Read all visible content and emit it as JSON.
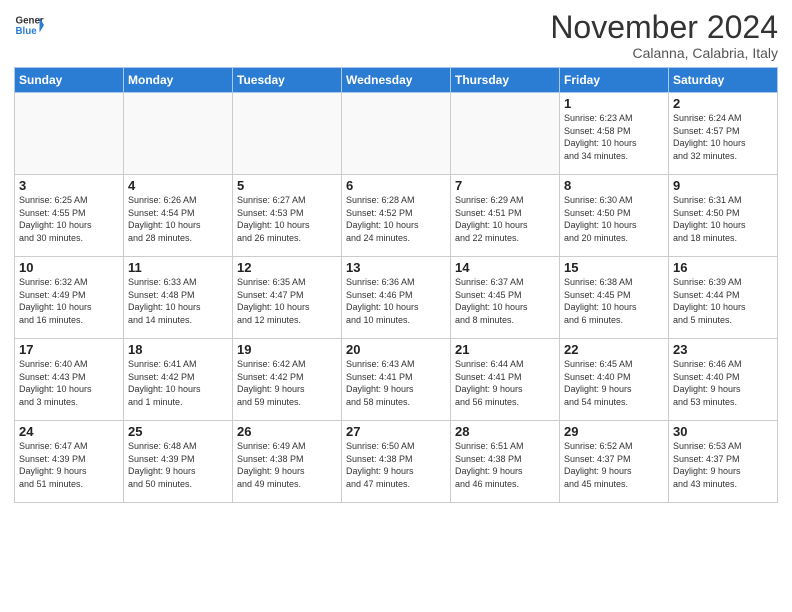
{
  "header": {
    "logo_line1": "General",
    "logo_line2": "Blue",
    "month": "November 2024",
    "location": "Calanna, Calabria, Italy"
  },
  "weekdays": [
    "Sunday",
    "Monday",
    "Tuesday",
    "Wednesday",
    "Thursday",
    "Friday",
    "Saturday"
  ],
  "weeks": [
    [
      {
        "day": "",
        "info": ""
      },
      {
        "day": "",
        "info": ""
      },
      {
        "day": "",
        "info": ""
      },
      {
        "day": "",
        "info": ""
      },
      {
        "day": "",
        "info": ""
      },
      {
        "day": "1",
        "info": "Sunrise: 6:23 AM\nSunset: 4:58 PM\nDaylight: 10 hours\nand 34 minutes."
      },
      {
        "day": "2",
        "info": "Sunrise: 6:24 AM\nSunset: 4:57 PM\nDaylight: 10 hours\nand 32 minutes."
      }
    ],
    [
      {
        "day": "3",
        "info": "Sunrise: 6:25 AM\nSunset: 4:55 PM\nDaylight: 10 hours\nand 30 minutes."
      },
      {
        "day": "4",
        "info": "Sunrise: 6:26 AM\nSunset: 4:54 PM\nDaylight: 10 hours\nand 28 minutes."
      },
      {
        "day": "5",
        "info": "Sunrise: 6:27 AM\nSunset: 4:53 PM\nDaylight: 10 hours\nand 26 minutes."
      },
      {
        "day": "6",
        "info": "Sunrise: 6:28 AM\nSunset: 4:52 PM\nDaylight: 10 hours\nand 24 minutes."
      },
      {
        "day": "7",
        "info": "Sunrise: 6:29 AM\nSunset: 4:51 PM\nDaylight: 10 hours\nand 22 minutes."
      },
      {
        "day": "8",
        "info": "Sunrise: 6:30 AM\nSunset: 4:50 PM\nDaylight: 10 hours\nand 20 minutes."
      },
      {
        "day": "9",
        "info": "Sunrise: 6:31 AM\nSunset: 4:50 PM\nDaylight: 10 hours\nand 18 minutes."
      }
    ],
    [
      {
        "day": "10",
        "info": "Sunrise: 6:32 AM\nSunset: 4:49 PM\nDaylight: 10 hours\nand 16 minutes."
      },
      {
        "day": "11",
        "info": "Sunrise: 6:33 AM\nSunset: 4:48 PM\nDaylight: 10 hours\nand 14 minutes."
      },
      {
        "day": "12",
        "info": "Sunrise: 6:35 AM\nSunset: 4:47 PM\nDaylight: 10 hours\nand 12 minutes."
      },
      {
        "day": "13",
        "info": "Sunrise: 6:36 AM\nSunset: 4:46 PM\nDaylight: 10 hours\nand 10 minutes."
      },
      {
        "day": "14",
        "info": "Sunrise: 6:37 AM\nSunset: 4:45 PM\nDaylight: 10 hours\nand 8 minutes."
      },
      {
        "day": "15",
        "info": "Sunrise: 6:38 AM\nSunset: 4:45 PM\nDaylight: 10 hours\nand 6 minutes."
      },
      {
        "day": "16",
        "info": "Sunrise: 6:39 AM\nSunset: 4:44 PM\nDaylight: 10 hours\nand 5 minutes."
      }
    ],
    [
      {
        "day": "17",
        "info": "Sunrise: 6:40 AM\nSunset: 4:43 PM\nDaylight: 10 hours\nand 3 minutes."
      },
      {
        "day": "18",
        "info": "Sunrise: 6:41 AM\nSunset: 4:42 PM\nDaylight: 10 hours\nand 1 minute."
      },
      {
        "day": "19",
        "info": "Sunrise: 6:42 AM\nSunset: 4:42 PM\nDaylight: 9 hours\nand 59 minutes."
      },
      {
        "day": "20",
        "info": "Sunrise: 6:43 AM\nSunset: 4:41 PM\nDaylight: 9 hours\nand 58 minutes."
      },
      {
        "day": "21",
        "info": "Sunrise: 6:44 AM\nSunset: 4:41 PM\nDaylight: 9 hours\nand 56 minutes."
      },
      {
        "day": "22",
        "info": "Sunrise: 6:45 AM\nSunset: 4:40 PM\nDaylight: 9 hours\nand 54 minutes."
      },
      {
        "day": "23",
        "info": "Sunrise: 6:46 AM\nSunset: 4:40 PM\nDaylight: 9 hours\nand 53 minutes."
      }
    ],
    [
      {
        "day": "24",
        "info": "Sunrise: 6:47 AM\nSunset: 4:39 PM\nDaylight: 9 hours\nand 51 minutes."
      },
      {
        "day": "25",
        "info": "Sunrise: 6:48 AM\nSunset: 4:39 PM\nDaylight: 9 hours\nand 50 minutes."
      },
      {
        "day": "26",
        "info": "Sunrise: 6:49 AM\nSunset: 4:38 PM\nDaylight: 9 hours\nand 49 minutes."
      },
      {
        "day": "27",
        "info": "Sunrise: 6:50 AM\nSunset: 4:38 PM\nDaylight: 9 hours\nand 47 minutes."
      },
      {
        "day": "28",
        "info": "Sunrise: 6:51 AM\nSunset: 4:38 PM\nDaylight: 9 hours\nand 46 minutes."
      },
      {
        "day": "29",
        "info": "Sunrise: 6:52 AM\nSunset: 4:37 PM\nDaylight: 9 hours\nand 45 minutes."
      },
      {
        "day": "30",
        "info": "Sunrise: 6:53 AM\nSunset: 4:37 PM\nDaylight: 9 hours\nand 43 minutes."
      }
    ]
  ]
}
